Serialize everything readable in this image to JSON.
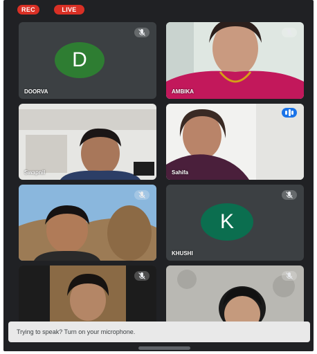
{
  "header": {
    "rec_label": "REC",
    "live_label": "LIVE"
  },
  "tiles": [
    {
      "name": "DOORVA",
      "avatar_letter": "D",
      "avatar_color": "#2e7d32",
      "muted": true
    },
    {
      "name": "AMBIKA",
      "muted": true
    },
    {
      "name": "Swapnil",
      "muted": false
    },
    {
      "name": "Sahifa",
      "speaking": true
    },
    {
      "name": "",
      "muted": true
    },
    {
      "name": "KHUSHI",
      "avatar_letter": "K",
      "avatar_color": "#0b6e4f",
      "muted": true
    },
    {
      "name": "",
      "muted": true
    },
    {
      "name": "",
      "muted": true
    }
  ],
  "toast": {
    "text": "Trying to speak? Turn on your microphone."
  }
}
